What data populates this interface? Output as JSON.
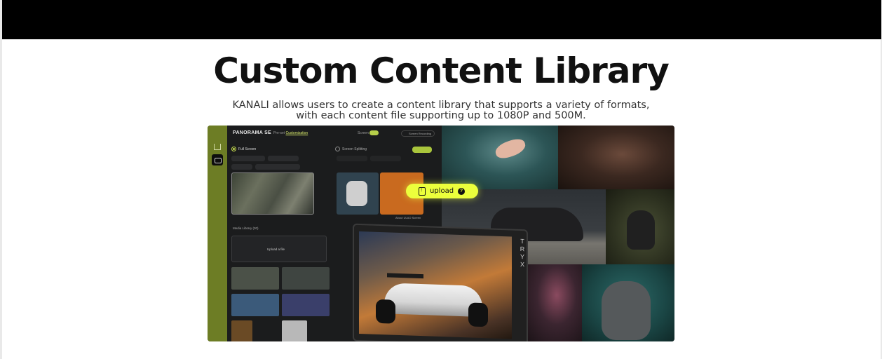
{
  "page": {
    "headline": "Custom Content Library",
    "subtitle_line1": "KANALI allows users to create a content library that supports a variety of formats,",
    "subtitle_line2": "with each content file supporting up to 1080P and 500M."
  },
  "app": {
    "brand": "PANORAMA SE",
    "mode_prefix": "Pre-set",
    "mode_active": "Customization",
    "screen_label": "Screen",
    "screen_recording": "Screen Recording",
    "full_screen": "Full Screen",
    "screen_splitting": "Screen Splitting",
    "about": "About ULAO Screen",
    "media_library": "Media Library (30)",
    "upload_file": "Upload a file"
  },
  "overlay": {
    "upload_label": "upload",
    "help_glyph": "?"
  },
  "device": {
    "brand_vertical": "TRYX"
  },
  "colors": {
    "accent": "#ecff3c",
    "sidebar_olive": "#6d7d25",
    "app_bg": "#1b1c1d"
  }
}
